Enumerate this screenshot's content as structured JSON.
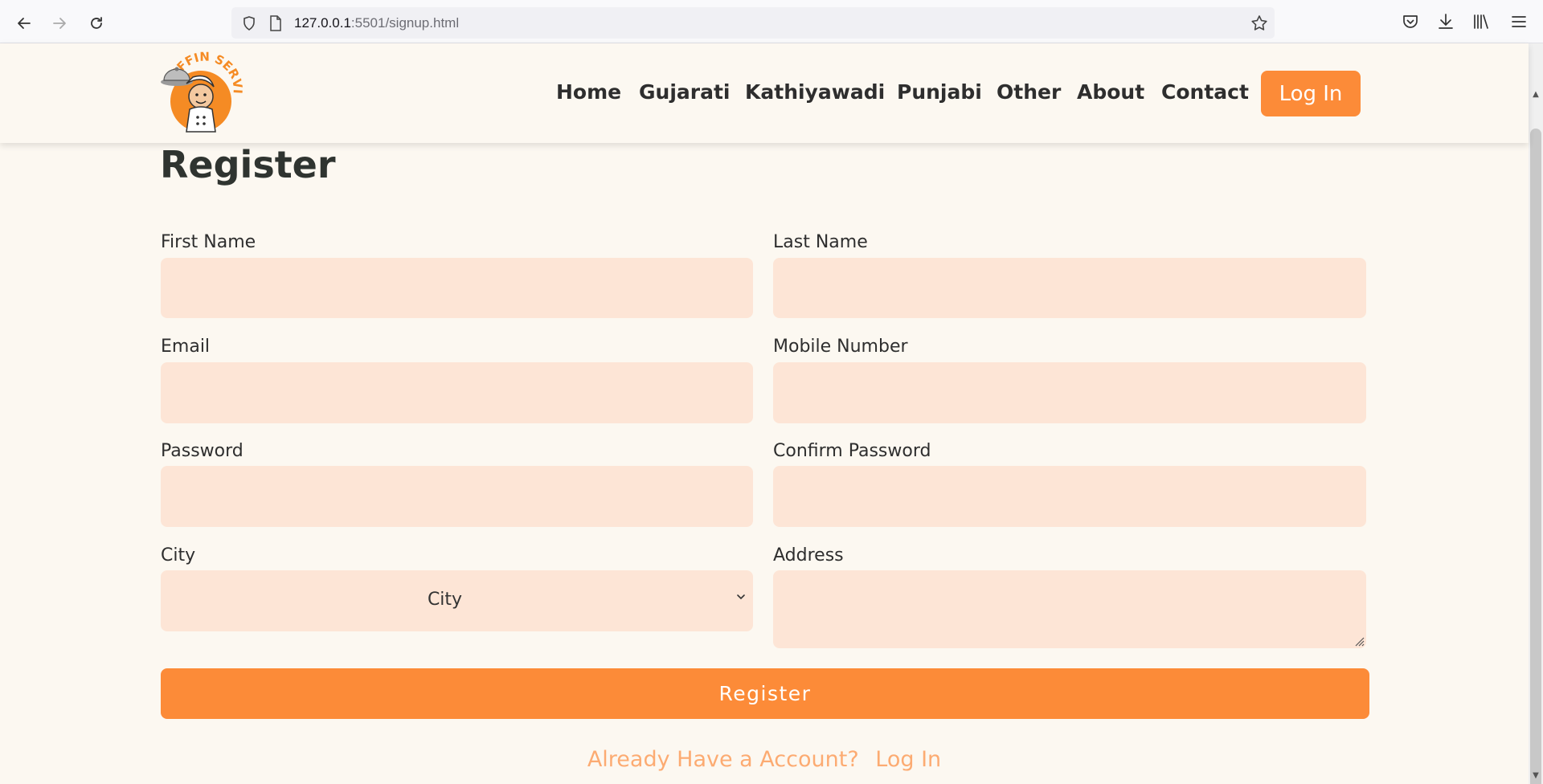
{
  "browser": {
    "url_host": "127.0.0.1",
    "url_rest": ":5501/signup.html"
  },
  "logo": {
    "text": "TIFFIN SERVICE"
  },
  "nav": {
    "items": [
      "Home",
      "Gujarati",
      "Kathiyawadi",
      "Punjabi",
      "Other",
      "About",
      "Contact"
    ],
    "login_label": "Log In"
  },
  "form": {
    "title": "Register",
    "first_name_label": "First Name",
    "last_name_label": "Last Name",
    "email_label": "Email",
    "mobile_label": "Mobile Number",
    "password_label": "Password",
    "confirm_password_label": "Confirm Password",
    "city_label": "City",
    "city_selected": "City",
    "address_label": "Address",
    "submit_label": "Register",
    "account_prompt": "Already Have a Account?",
    "login_link": "Log In"
  },
  "colors": {
    "accent": "#fc8b38",
    "field_bg": "#fde5d6",
    "page_bg": "#fcf8f1",
    "link": "#fcab72"
  }
}
